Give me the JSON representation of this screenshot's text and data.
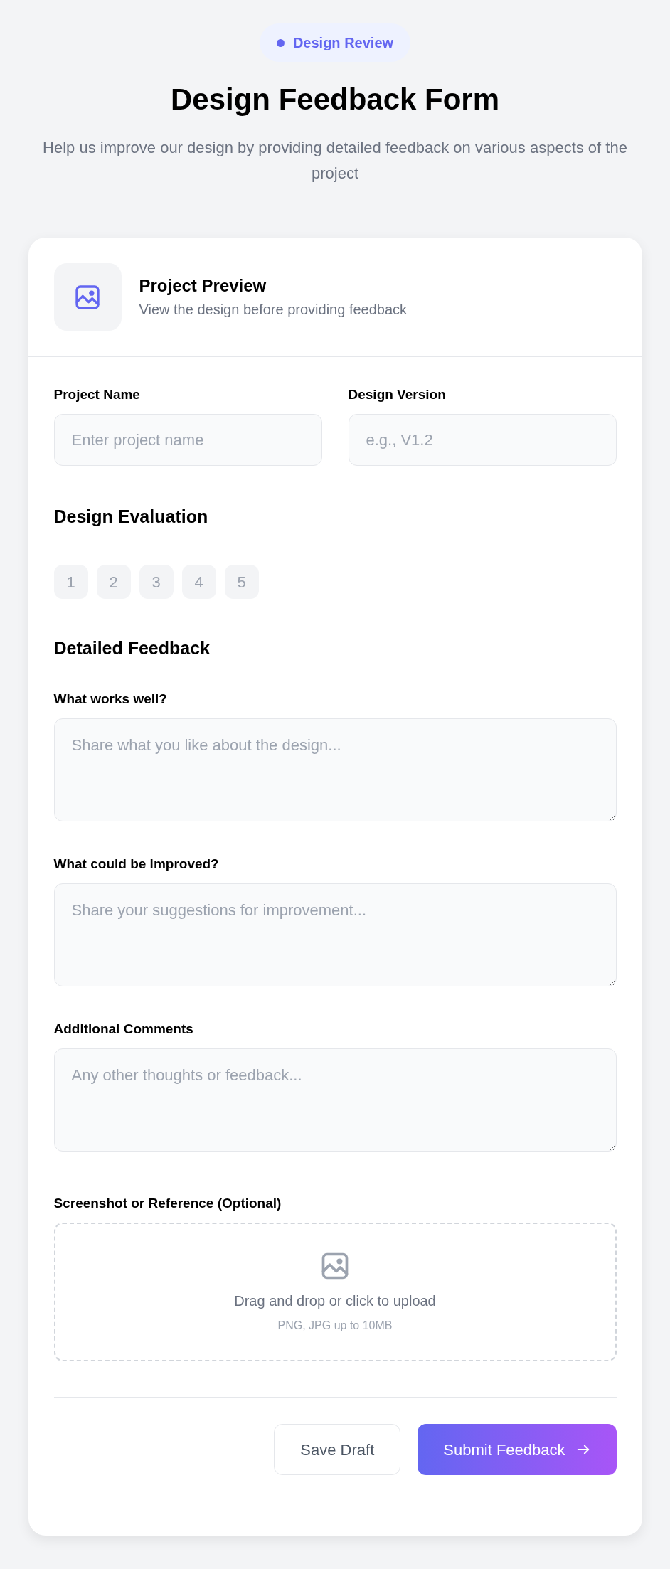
{
  "badge": {
    "label": "Design Review",
    "color": "#6366f1"
  },
  "header": {
    "title": "Design Feedback Form",
    "subtitle": "Help us improve our design by providing detailed feedback on various aspects of the project"
  },
  "preview": {
    "title": "Project Preview",
    "subtitle": "View the design before providing feedback"
  },
  "fields": [
    {
      "label": "Project Name",
      "placeholder": "Enter project name"
    },
    {
      "label": "Design Version",
      "placeholder": "e.g., V1.2"
    }
  ],
  "evaluation": {
    "title": "Design Evaluation",
    "ratings": [
      {
        "label": "1",
        "selected": false
      },
      {
        "label": "2",
        "selected": false
      },
      {
        "label": "3",
        "selected": false
      },
      {
        "label": "4",
        "selected": false
      },
      {
        "label": "5",
        "selected": false
      }
    ]
  },
  "feedback": {
    "title": "Detailed Feedback",
    "questions": [
      {
        "label": "What works well?",
        "placeholder": "Share what you like about the design..."
      },
      {
        "label": "What could be improved?",
        "placeholder": "Share your suggestions for improvement..."
      },
      {
        "label": "Additional Comments",
        "placeholder": "Any other thoughts or feedback..."
      }
    ]
  },
  "upload": {
    "label": "Screenshot or Reference (Optional)",
    "prompt": "Drag and drop or click to upload",
    "hint": "PNG, JPG up to 10MB"
  },
  "buttons": [
    {
      "label": "Save Draft",
      "kind": "secondary"
    },
    {
      "label": "Submit Feedback",
      "kind": "primary"
    }
  ]
}
